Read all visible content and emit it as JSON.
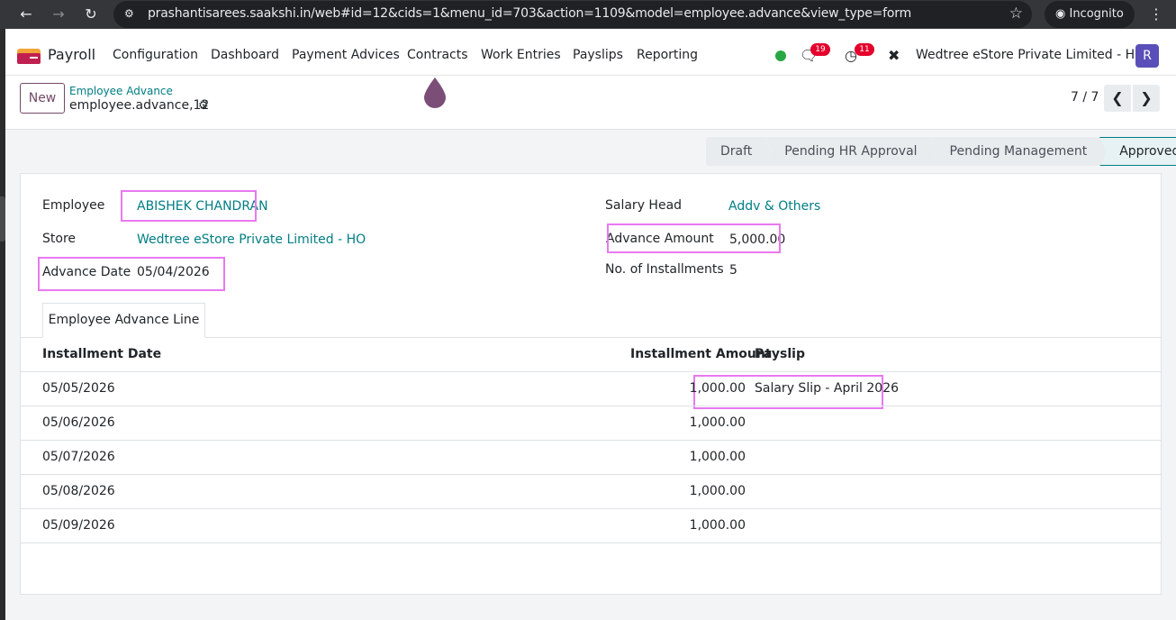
{
  "browser": {
    "url": "prashantisarees.saakshi.in/web#id=12&cids=1&menu_id=703&action=1109&model=employee.advance&view_type=form",
    "incognito_label": "Incognito"
  },
  "navbar": {
    "app_name": "Payroll",
    "menu": [
      "Configuration",
      "Dashboard",
      "Payment Advices",
      "Contracts",
      "Work Entries",
      "Payslips",
      "Reporting"
    ],
    "messages_count": "19",
    "activities_count": "11",
    "company": "Wedtree eStore Private Limited - HO",
    "avatar_letter": "R"
  },
  "control_panel": {
    "new_label": "New",
    "breadcrumb": "Employee Advance",
    "record_name": "employee.advance,12",
    "pager": "7 / 7"
  },
  "statusbar": {
    "stages": [
      "Draft",
      "Pending HR Approval",
      "Pending Management",
      "Approved"
    ],
    "active": "Approved"
  },
  "form": {
    "employee_label": "Employee",
    "employee_value": "ABISHEK CHANDRAN",
    "store_label": "Store",
    "store_value": "Wedtree eStore Private Limited - HO",
    "advance_date_label": "Advance Date",
    "advance_date_value": "05/04/2026",
    "salary_head_label": "Salary Head",
    "salary_head_value": "Addv & Others",
    "advance_amount_label": "Advance Amount",
    "advance_amount_value": "5,000.00",
    "installments_label": "No. of Installments",
    "installments_value": "5"
  },
  "tab": {
    "label": "Employee Advance Line"
  },
  "table": {
    "headers": [
      "Installment Date",
      "Installment Amount",
      "Payslip"
    ],
    "rows": [
      {
        "date": "05/05/2026",
        "amount": "1,000.00",
        "payslip": "Salary Slip - April 2026"
      },
      {
        "date": "05/06/2026",
        "amount": "1,000.00",
        "payslip": ""
      },
      {
        "date": "05/07/2026",
        "amount": "1,000.00",
        "payslip": ""
      },
      {
        "date": "05/08/2026",
        "amount": "1,000.00",
        "payslip": ""
      },
      {
        "date": "05/09/2026",
        "amount": "1,000.00",
        "payslip": ""
      }
    ]
  },
  "colors": {
    "brand": "#714b67",
    "link": "#017e84",
    "highlight": "#e879f0",
    "badge": "#e4002b",
    "online": "#28a745"
  }
}
